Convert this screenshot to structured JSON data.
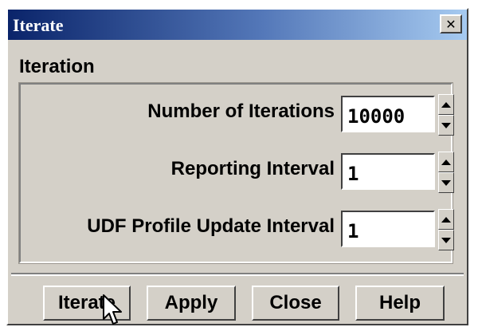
{
  "window": {
    "title": "Iterate",
    "close_glyph": "✕"
  },
  "group": {
    "label": "Iteration",
    "rows": [
      {
        "label": "Number of Iterations",
        "value": "10000"
      },
      {
        "label": "Reporting Interval",
        "value": "1"
      },
      {
        "label": "UDF Profile Update Interval",
        "value": "1"
      }
    ]
  },
  "buttons": {
    "iterate": "Iterate",
    "apply": "Apply",
    "close": "Close",
    "help": "Help"
  },
  "icons": {
    "spin_up": "triangle-up-icon",
    "spin_down": "triangle-down-icon",
    "cursor": "mouse-pointer-icon"
  }
}
